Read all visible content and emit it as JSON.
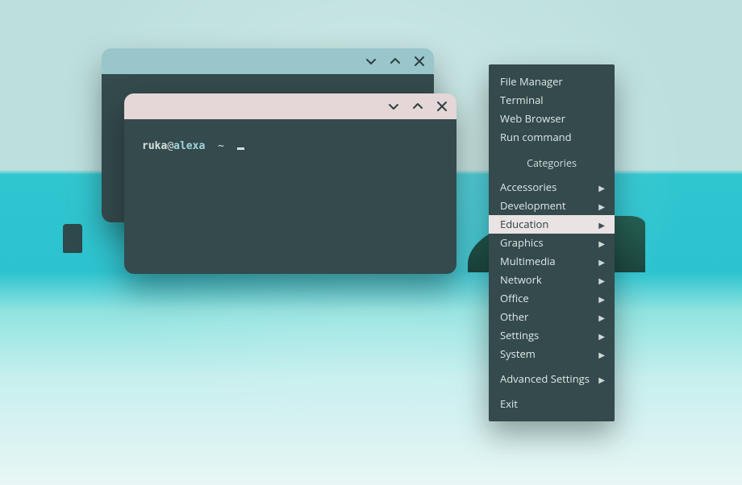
{
  "colors": {
    "panel_bg": "#344a4c",
    "titlebar_back": "#99c6cb",
    "titlebar_front": "#e5d6d7",
    "menu_hover_bg": "#e9e3e3",
    "menu_text": "#dfe8e8"
  },
  "terminal": {
    "user": "ruka",
    "at": "@",
    "host": "alexa",
    "cwd": "~"
  },
  "menu": {
    "launchers": {
      "file_manager": "File Manager",
      "terminal": "Terminal",
      "web_browser": "Web Browser",
      "run_command": "Run command"
    },
    "categories_header": "Categories",
    "categories": {
      "accessories": "Accessories",
      "development": "Development",
      "education": "Education",
      "graphics": "Graphics",
      "multimedia": "Multimedia",
      "network": "Network",
      "office": "Office",
      "other": "Other",
      "settings": "Settings",
      "system": "System"
    },
    "advanced_settings": "Advanced Settings",
    "exit": "Exit",
    "highlighted": "education"
  }
}
